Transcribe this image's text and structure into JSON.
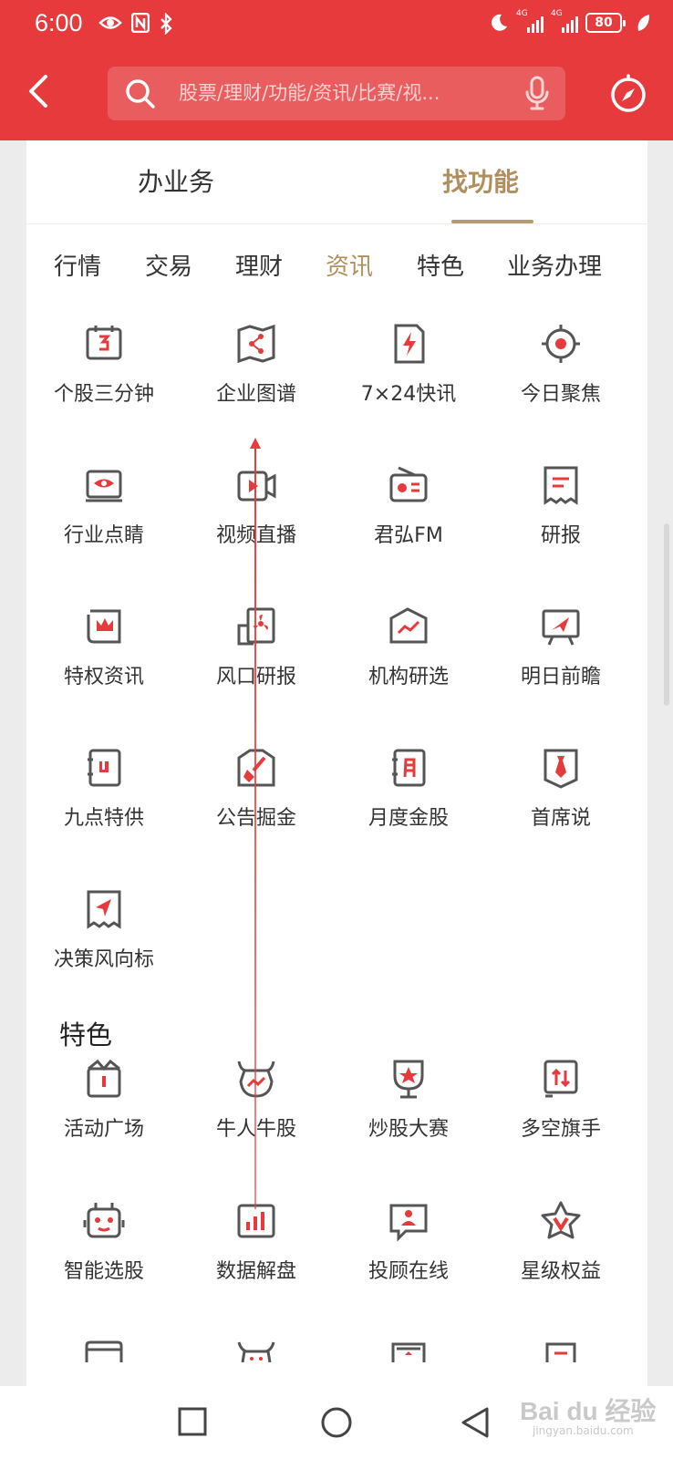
{
  "status_bar": {
    "time": "6:00",
    "network_1": "4G",
    "network_2": "4G",
    "battery": "80",
    "icons": [
      "eye-icon",
      "nfc-icon",
      "bluetooth-icon",
      "moon-icon",
      "signal-icon",
      "leaf-icon"
    ]
  },
  "header": {
    "search_placeholder": "股票/理财/功能/资讯/比赛/视...",
    "icons": [
      "back-icon",
      "search-icon",
      "microphone-icon",
      "compass-icon"
    ]
  },
  "main_tabs": [
    {
      "label": "办业务",
      "active": false
    },
    {
      "label": "找功能",
      "active": true
    }
  ],
  "category_tabs": [
    {
      "label": "行情",
      "active": false
    },
    {
      "label": "交易",
      "active": false
    },
    {
      "label": "理财",
      "active": false
    },
    {
      "label": "资讯",
      "active": true
    },
    {
      "label": "特色",
      "active": false
    },
    {
      "label": "业务办理",
      "active": false
    }
  ],
  "news_items": [
    {
      "label": "个股三分钟",
      "icon": "calendar-icon"
    },
    {
      "label": "企业图谱",
      "icon": "share-map-icon"
    },
    {
      "label": "7×24快讯",
      "icon": "flash-news-icon"
    },
    {
      "label": "今日聚焦",
      "icon": "target-icon"
    },
    {
      "label": "行业点睛",
      "icon": "eye-screen-icon"
    },
    {
      "label": "视频直播",
      "icon": "video-icon"
    },
    {
      "label": "君弘FM",
      "icon": "radio-icon"
    },
    {
      "label": "研报",
      "icon": "report-icon"
    },
    {
      "label": "特权资讯",
      "icon": "crown-scroll-icon"
    },
    {
      "label": "风口研报",
      "icon": "fan-report-icon"
    },
    {
      "label": "机构研选",
      "icon": "trend-folder-icon"
    },
    {
      "label": "明日前瞻",
      "icon": "telescope-board-icon"
    },
    {
      "label": "九点特供",
      "icon": "clock-notebook-icon"
    },
    {
      "label": "公告掘金",
      "icon": "shovel-icon"
    },
    {
      "label": "月度金股",
      "icon": "month-calendar-icon"
    },
    {
      "label": "首席说",
      "icon": "tie-icon"
    },
    {
      "label": "决策风向标",
      "icon": "compass-scroll-icon"
    }
  ],
  "section_title": "特色",
  "feature_items": [
    {
      "label": "活动广场",
      "icon": "gift-board-icon"
    },
    {
      "label": "牛人牛股",
      "icon": "bull-icon"
    },
    {
      "label": "炒股大赛",
      "icon": "trophy-icon"
    },
    {
      "label": "多空旗手",
      "icon": "flag-arrows-icon"
    },
    {
      "label": "智能选股",
      "icon": "robot-icon"
    },
    {
      "label": "数据解盘",
      "icon": "bar-chart-icon"
    },
    {
      "label": "投顾在线",
      "icon": "advisor-chat-icon"
    },
    {
      "label": "星级权益",
      "icon": "star-badge-icon"
    }
  ],
  "watermark": {
    "brand": "Bai du 经验",
    "sub": "jingyan.baidu.com"
  },
  "colors": {
    "brand_red": "#e63a3c",
    "gold": "#b08f5f",
    "icon_dark": "#555555",
    "icon_red": "#e63a3c"
  }
}
